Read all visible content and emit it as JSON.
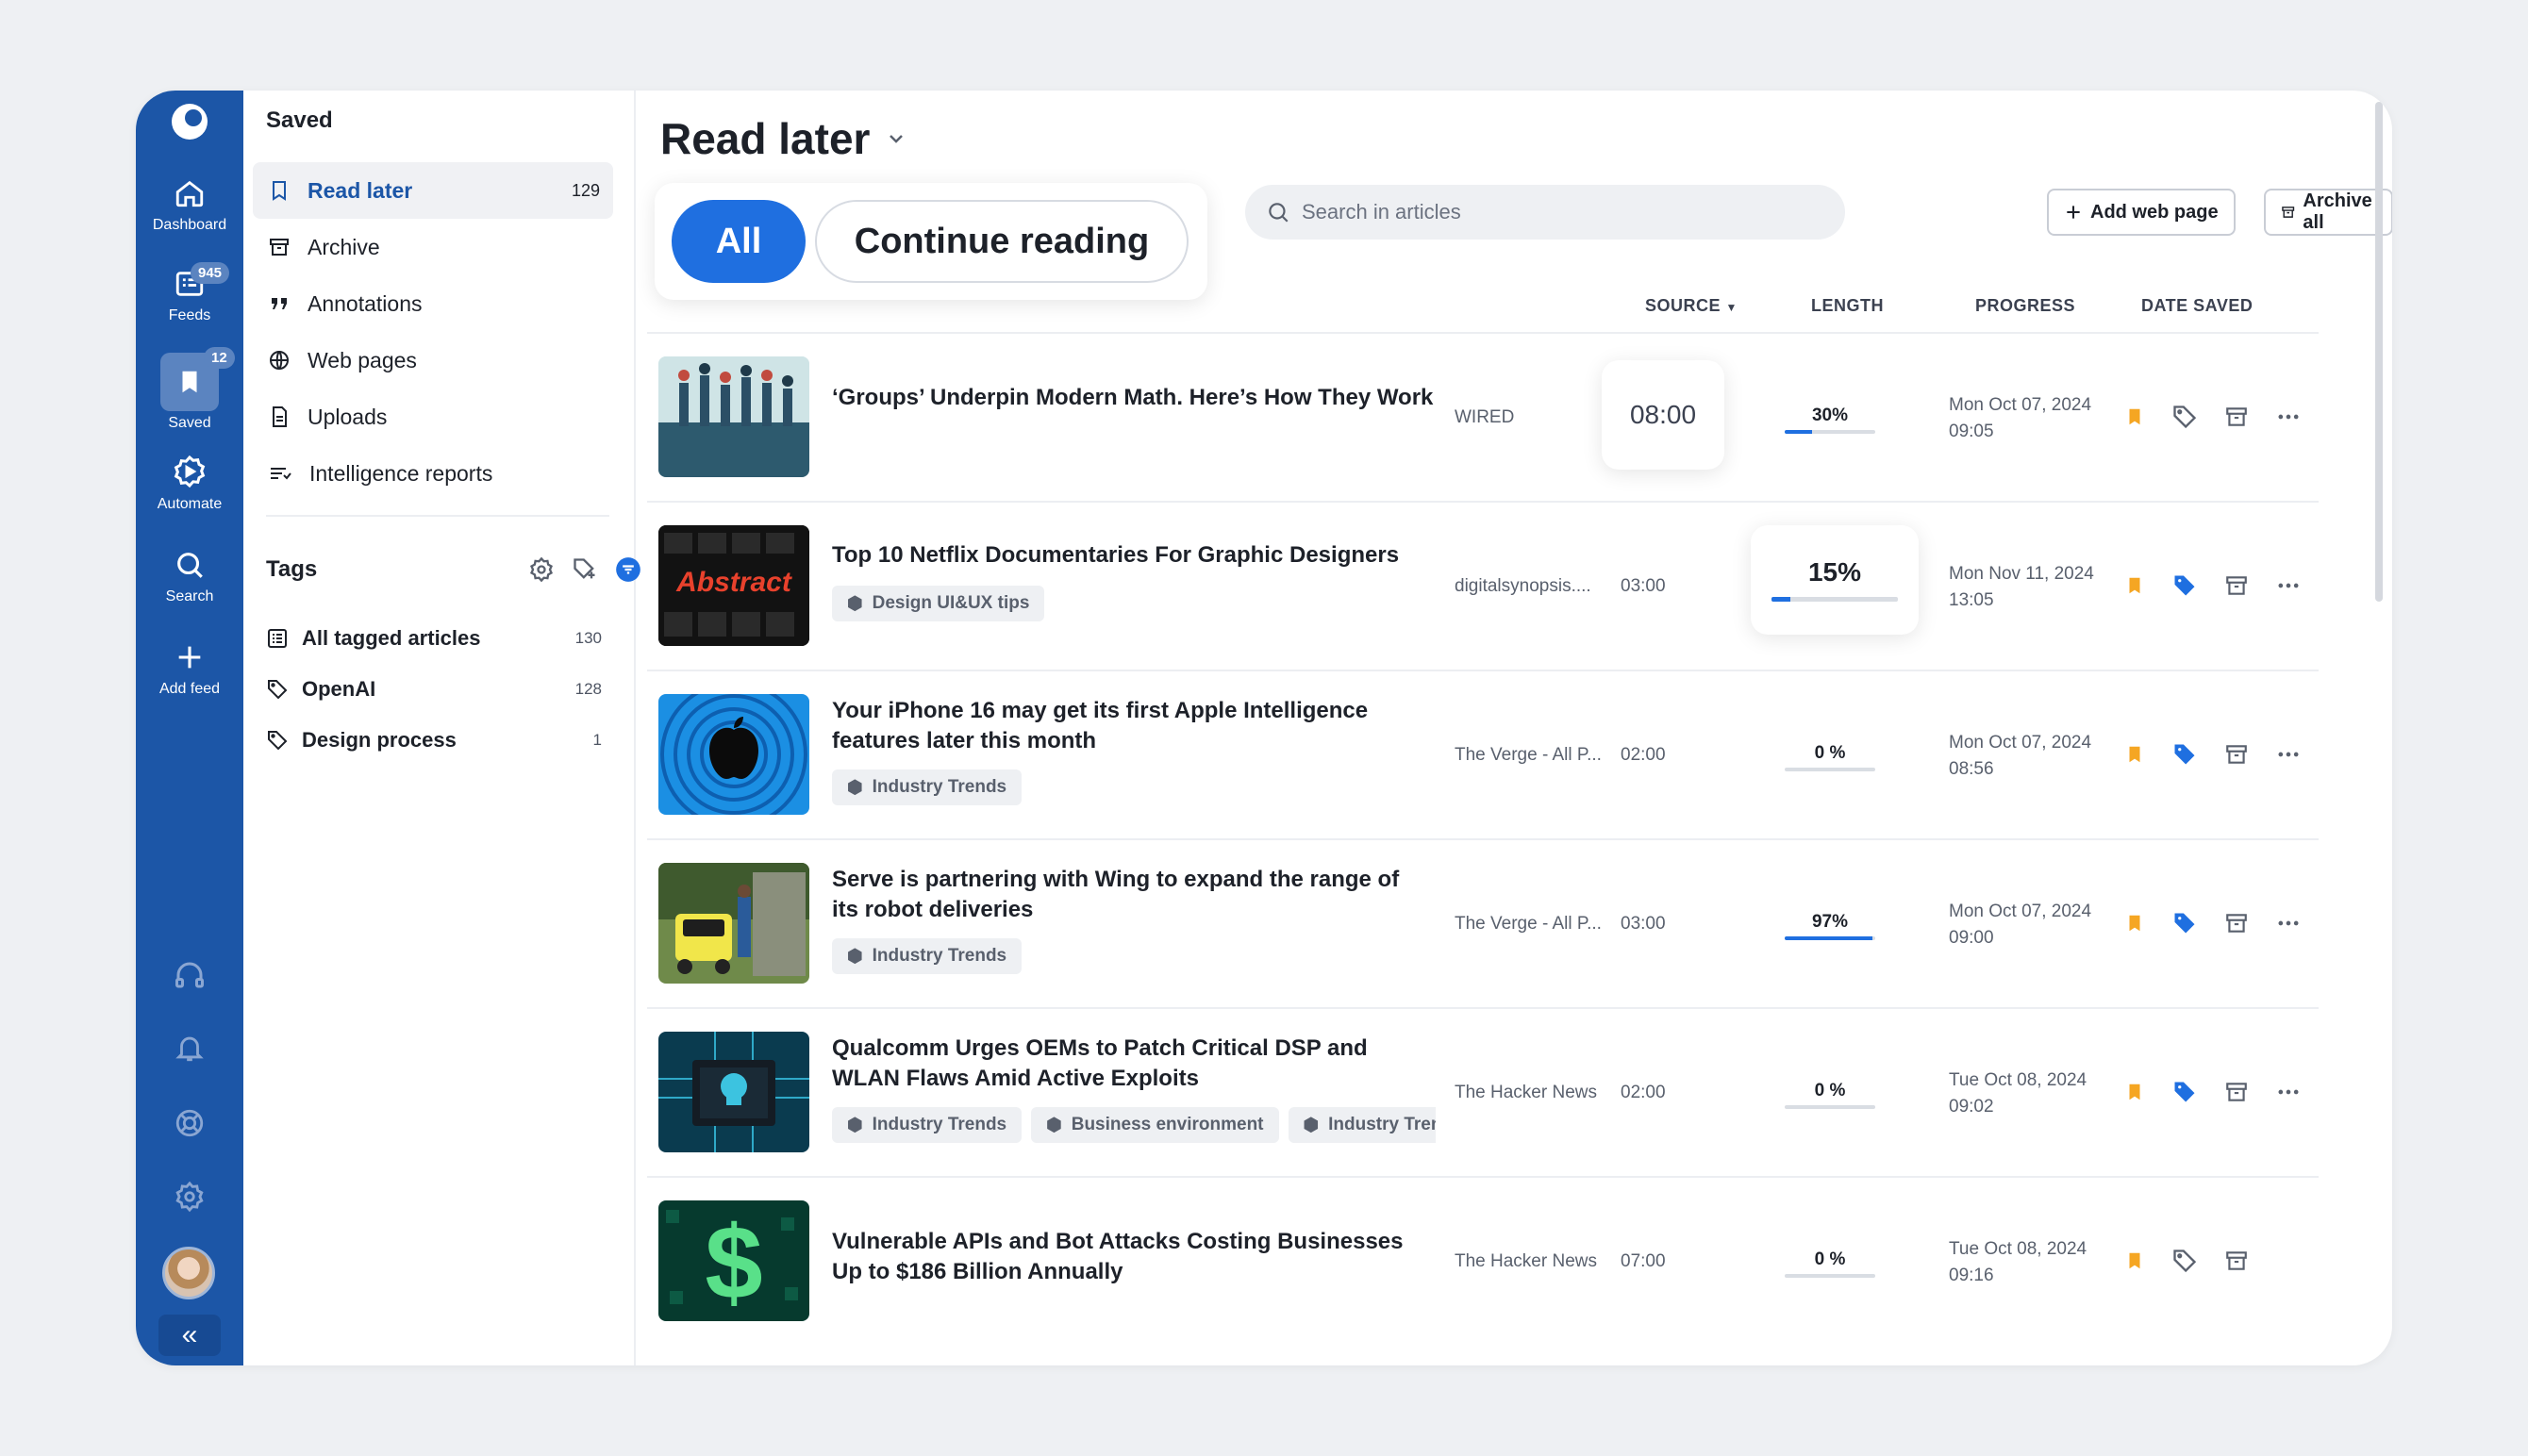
{
  "rail": {
    "items": [
      {
        "label": "Dashboard"
      },
      {
        "label": "Feeds",
        "badge": "945"
      },
      {
        "label": "Saved",
        "badge": "12"
      },
      {
        "label": "Automate"
      },
      {
        "label": "Search"
      },
      {
        "label": "Add feed"
      }
    ],
    "collapse_glyph": "«"
  },
  "sidebar": {
    "title": "Saved",
    "nav": [
      {
        "label": "Read later",
        "count": "129",
        "icon": "bookmark-icon"
      },
      {
        "label": "Archive",
        "count": "",
        "icon": "archive-icon"
      },
      {
        "label": "Annotations",
        "count": "",
        "icon": "quote-icon"
      },
      {
        "label": "Web pages",
        "count": "",
        "icon": "globe-icon"
      },
      {
        "label": "Uploads",
        "count": "",
        "icon": "file-icon"
      },
      {
        "label": "Intelligence reports",
        "count": "",
        "icon": "report-icon"
      }
    ],
    "tags_title": "Tags",
    "tags": [
      {
        "label": "All tagged articles",
        "count": "130"
      },
      {
        "label": "OpenAI",
        "count": "128"
      },
      {
        "label": "Design process",
        "count": "1"
      }
    ]
  },
  "main": {
    "title": "Read later",
    "segments": {
      "all": "All",
      "continue": "Continue reading"
    },
    "search_placeholder": "Search in articles",
    "add_web_page": "Add web page",
    "archive_all": "Archive all",
    "columns": {
      "source": "SOURCE",
      "length": "LENGTH",
      "progress": "PROGRESS",
      "date_saved": "DATE SAVED"
    },
    "accent": "#1f6fe0",
    "bookmark_color": "#f5a623",
    "articles": [
      {
        "title_lines": [
          "‘Groups’ Underpin Modern Math. Here’s How They Work"
        ],
        "tags": [],
        "source": "WIRED",
        "length": "08:00",
        "progress_label": "30%",
        "progress": 0.3,
        "date": "Mon Oct 07, 2024",
        "time": "09:05",
        "tag_filled": false
      },
      {
        "title_lines": [
          "Top 10 Netflix Documentaries For Graphic Designers"
        ],
        "tags": [
          "Design UI&UX tips"
        ],
        "source": "digitalsynopsis....",
        "length": "03:00",
        "progress_label": "15%",
        "progress": 0.15,
        "date": "Mon Nov 11, 2024",
        "time": "13:05",
        "tag_filled": true
      },
      {
        "title_lines": [
          "Your iPhone 16 may get its first Apple Intelligence",
          "features later this month"
        ],
        "tags": [
          "Industry Trends"
        ],
        "source": "The Verge - All P...",
        "length": "02:00",
        "progress_label": "0 %",
        "progress": 0,
        "date": "Mon Oct 07, 2024",
        "time": "08:56",
        "tag_filled": true
      },
      {
        "title_lines": [
          "Serve is partnering with Wing to expand the range of",
          "its robot deliveries"
        ],
        "tags": [
          "Industry Trends"
        ],
        "source": "The Verge - All P...",
        "length": "03:00",
        "progress_label": "97%",
        "progress": 0.97,
        "date": "Mon Oct 07, 2024",
        "time": "09:00",
        "tag_filled": true
      },
      {
        "title_lines": [
          "Qualcomm Urges OEMs to Patch Critical DSP and",
          "WLAN Flaws Amid Active Exploits"
        ],
        "tags": [
          "Industry Trends",
          "Business environment",
          "Industry Trends"
        ],
        "source": "The Hacker News",
        "length": "02:00",
        "progress_label": "0 %",
        "progress": 0,
        "date": "Tue Oct 08, 2024",
        "time": "09:02",
        "tag_filled": true
      },
      {
        "title_lines": [
          "Vulnerable APIs and Bot Attacks Costing Businesses",
          "Up to $186 Billion Annually"
        ],
        "tags": [],
        "source": "The Hacker News",
        "length": "07:00",
        "progress_label": "0 %",
        "progress": 0,
        "date": "Tue Oct 08, 2024",
        "time": "09:16",
        "tag_filled": false
      }
    ]
  }
}
